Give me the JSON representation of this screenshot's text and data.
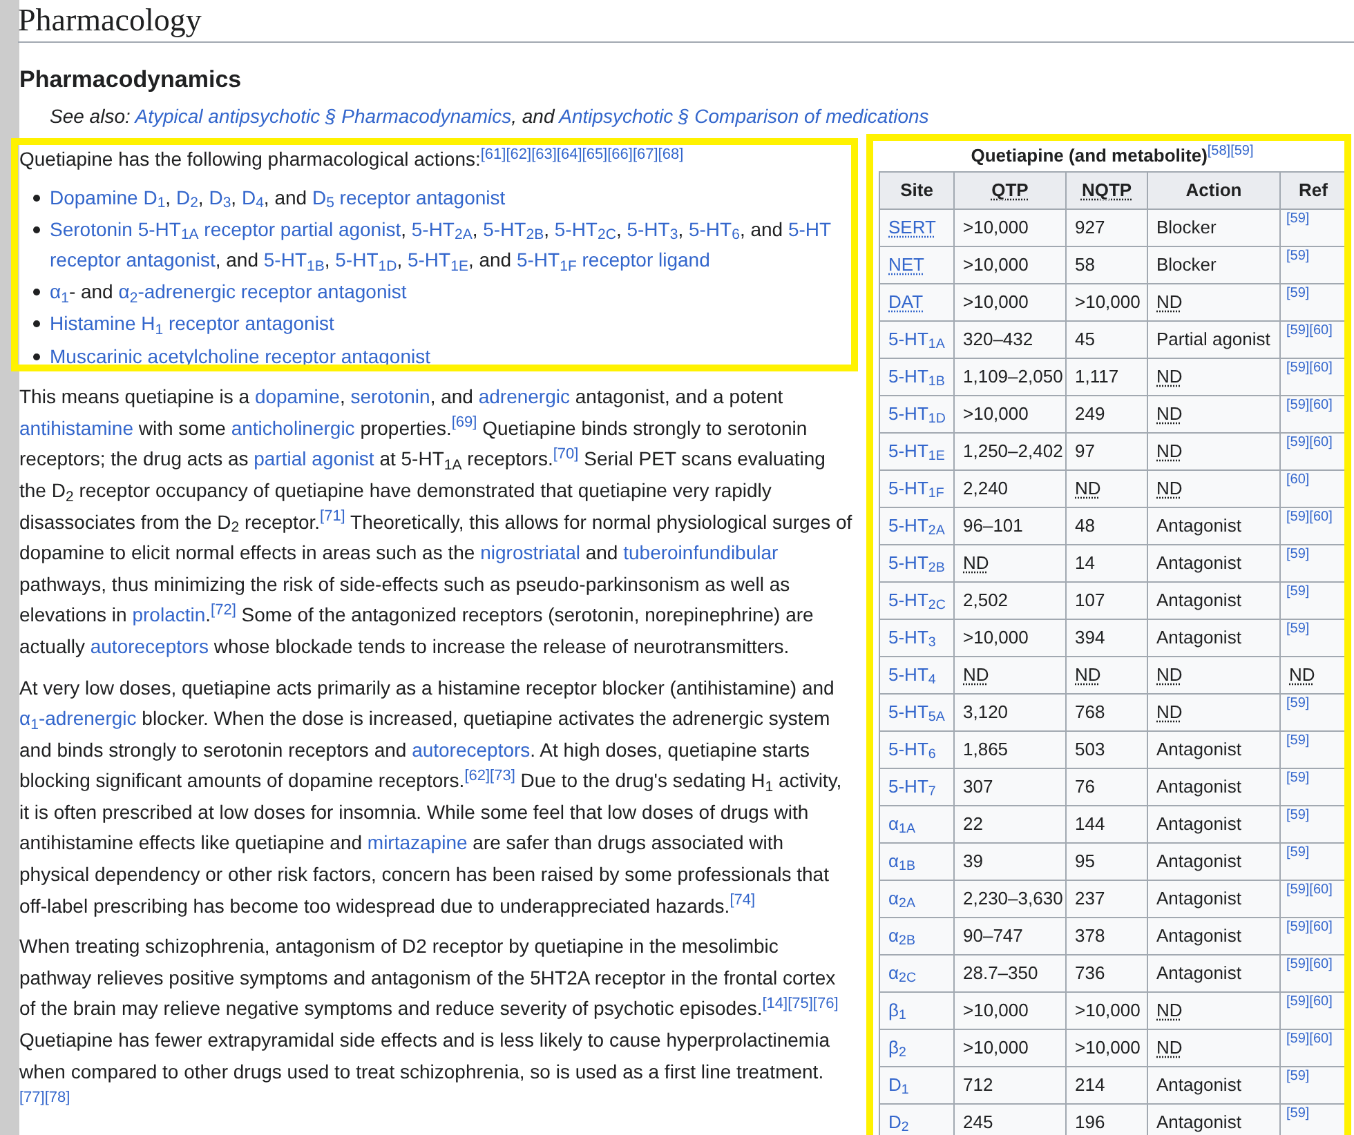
{
  "title": "Pharmacology",
  "section": "Pharmacodynamics",
  "see_also": [
    {
      "kind": "italic",
      "text": "See also: "
    },
    {
      "kind": "link",
      "text": "Atypical antipsychotic § Pharmacodynamics"
    },
    {
      "kind": "italic",
      "text": ", and "
    },
    {
      "kind": "link",
      "text": "Antipsychotic § Comparison of medications"
    }
  ],
  "intro": [
    {
      "kind": "text",
      "text": "Quetiapine has the following pharmacological actions:"
    },
    {
      "kind": "ref",
      "text": "[61][62][63][64][65][66][67][68]"
    }
  ],
  "bullets": [
    [
      {
        "kind": "link",
        "text": "Dopamine D$_{1}$"
      },
      {
        "kind": "text",
        "text": ", "
      },
      {
        "kind": "link",
        "text": "D$_{2}$"
      },
      {
        "kind": "text",
        "text": ", "
      },
      {
        "kind": "link",
        "text": "D$_{3}$"
      },
      {
        "kind": "text",
        "text": ", "
      },
      {
        "kind": "link",
        "text": "D$_{4}$"
      },
      {
        "kind": "text",
        "text": ", and "
      },
      {
        "kind": "link",
        "text": "D$_{5}$ receptor antagonist"
      }
    ],
    [
      {
        "kind": "link",
        "text": "Serotonin 5-HT$_{1A}$ receptor partial agonist"
      },
      {
        "kind": "text",
        "text": ", "
      },
      {
        "kind": "link",
        "text": "5-HT$_{2A}$"
      },
      {
        "kind": "text",
        "text": ", "
      },
      {
        "kind": "link",
        "text": "5-HT$_{2B}$"
      },
      {
        "kind": "text",
        "text": ", "
      },
      {
        "kind": "link",
        "text": "5-HT$_{2C}$"
      },
      {
        "kind": "text",
        "text": ", "
      },
      {
        "kind": "link",
        "text": "5-HT$_{3}$"
      },
      {
        "kind": "text",
        "text": ", "
      },
      {
        "kind": "link",
        "text": "5-HT$_{6}$"
      },
      {
        "kind": "text",
        "text": ", and "
      },
      {
        "kind": "link",
        "text": "5-HT"
      },
      {
        "kind": "link",
        "text": "receptor antagonist"
      },
      {
        "kind": "text",
        "text": ", and "
      },
      {
        "kind": "link",
        "text": "5-HT$_{1B}$"
      },
      {
        "kind": "text",
        "text": ", "
      },
      {
        "kind": "link",
        "text": "5-HT$_{1D}$"
      },
      {
        "kind": "text",
        "text": ", "
      },
      {
        "kind": "link",
        "text": "5-HT$_{1E}$"
      },
      {
        "kind": "text",
        "text": ", and "
      },
      {
        "kind": "link",
        "text": "5-HT$_{1F}$ receptor ligand"
      }
    ],
    [
      {
        "kind": "link",
        "text": "α$_{1}$"
      },
      {
        "kind": "text",
        "text": "- and "
      },
      {
        "kind": "link",
        "text": "α$_{2}$-adrenergic receptor antagonist"
      }
    ],
    [
      {
        "kind": "link",
        "text": "Histamine H$_{1}$ receptor antagonist"
      }
    ],
    [
      {
        "kind": "link",
        "text": "Muscarinic acetylcholine receptor antagonist"
      }
    ]
  ],
  "paragraphs": [
    [
      {
        "kind": "text",
        "text": "This means quetiapine is a "
      },
      {
        "kind": "link",
        "text": "dopamine"
      },
      {
        "kind": "text",
        "text": ", "
      },
      {
        "kind": "link",
        "text": "serotonin"
      },
      {
        "kind": "text",
        "text": ", and "
      },
      {
        "kind": "link",
        "text": "adrenergic"
      },
      {
        "kind": "text",
        "text": " antagonist, and a potent "
      },
      {
        "kind": "link",
        "text": "antihistamine"
      },
      {
        "kind": "text",
        "text": " with some "
      },
      {
        "kind": "link",
        "text": "anticholinergic"
      },
      {
        "kind": "text",
        "text": " properties."
      },
      {
        "kind": "ref",
        "text": "[69]"
      },
      {
        "kind": "text",
        "text": " Quetiapine binds strongly to serotonin receptors; the drug acts as "
      },
      {
        "kind": "link",
        "text": "partial agonist"
      },
      {
        "kind": "text",
        "text": " at 5-HT$_{1A}$ receptors."
      },
      {
        "kind": "ref",
        "text": "[70]"
      },
      {
        "kind": "text",
        "text": " Serial PET scans evaluating the D$_{2}$ receptor occupancy of quetiapine have demonstrated that quetiapine very rapidly disassociates from the D$_{2}$ receptor."
      },
      {
        "kind": "ref",
        "text": "[71]"
      },
      {
        "kind": "text",
        "text": " Theoretically, this allows for normal physiological surges of dopamine to elicit normal effects in areas such as the "
      },
      {
        "kind": "link",
        "text": "nigrostriatal"
      },
      {
        "kind": "text",
        "text": " and "
      },
      {
        "kind": "link",
        "text": "tuberoinfundibular"
      },
      {
        "kind": "text",
        "text": " pathways, thus minimizing the risk of side-effects such as pseudo-parkinsonism as well as elevations in "
      },
      {
        "kind": "link",
        "text": "prolactin"
      },
      {
        "kind": "text",
        "text": "."
      },
      {
        "kind": "ref",
        "text": "[72]"
      },
      {
        "kind": "text",
        "text": " Some of the antagonized receptors (serotonin, norepinephrine) are actually "
      },
      {
        "kind": "link",
        "text": "autoreceptors"
      },
      {
        "kind": "text",
        "text": " whose blockade tends to increase the release of neurotransmitters."
      }
    ],
    [
      {
        "kind": "text",
        "text": "At very low doses, quetiapine acts primarily as a histamine receptor blocker (antihistamine) and "
      },
      {
        "kind": "link",
        "text": "α$_{1}$-adrenergic"
      },
      {
        "kind": "text",
        "text": " blocker. When the dose is increased, quetiapine activates the adrenergic system and binds strongly to serotonin receptors and "
      },
      {
        "kind": "link",
        "text": "autoreceptors"
      },
      {
        "kind": "text",
        "text": ". At high doses, quetiapine starts blocking significant amounts of dopamine receptors."
      },
      {
        "kind": "ref",
        "text": "[62][73]"
      },
      {
        "kind": "text",
        "text": " Due to the drug's sedating H$_{1}$ activity, it is often prescribed at low doses for insomnia. While some feel that low doses of drugs with antihistamine effects like quetiapine and "
      },
      {
        "kind": "link",
        "text": "mirtazapine"
      },
      {
        "kind": "text",
        "text": " are safer than drugs associated with physical dependency or other risk factors, concern has been raised by some professionals that off-label prescribing has become too widespread due to underappreciated hazards."
      },
      {
        "kind": "ref",
        "text": "[74]"
      }
    ],
    [
      {
        "kind": "text",
        "text": "When treating schizophrenia, antagonism of D2 receptor by quetiapine in the mesolimbic pathway relieves positive symptoms and antagonism of the 5HT2A receptor in the frontal cortex of the brain may relieve negative symptoms and reduce severity of psychotic episodes."
      },
      {
        "kind": "ref",
        "text": "[14][75][76]"
      },
      {
        "kind": "text",
        "text": " Quetiapine has fewer extrapyramidal side effects and is less likely to cause hyperprolactinemia when compared to other drugs used to treat schizophrenia, so is used as a first line treatment."
      },
      {
        "kind": "ref",
        "text": "[77][78]"
      }
    ]
  ],
  "table": {
    "caption": "Quetiapine (and metabolite)",
    "caption_ref": "[58][59]",
    "columns": [
      {
        "label": "Site",
        "dotted": false
      },
      {
        "label": "QTP",
        "dotted": true
      },
      {
        "label": "NQTP",
        "dotted": true
      },
      {
        "label": "Action",
        "dotted": false
      },
      {
        "label": "Ref",
        "dotted": false
      }
    ],
    "rows": [
      {
        "cells": [
          {
            "text": "SERT",
            "abbr": true
          },
          {
            "text": ">10,000",
            "abbr": false
          },
          {
            "text": "927",
            "abbr": false
          },
          {
            "text": "Blocker",
            "abbr": false
          },
          {
            "text": "[59]",
            "abbr": false
          }
        ]
      },
      {
        "cells": [
          {
            "text": "NET",
            "abbr": true
          },
          {
            "text": ">10,000",
            "abbr": false
          },
          {
            "text": "58",
            "abbr": false
          },
          {
            "text": "Blocker",
            "abbr": false
          },
          {
            "text": "[59]",
            "abbr": false
          }
        ]
      },
      {
        "cells": [
          {
            "text": "DAT",
            "abbr": true
          },
          {
            "text": ">10,000",
            "abbr": false
          },
          {
            "text": ">10,000",
            "abbr": false
          },
          {
            "text": "ND",
            "abbr": true
          },
          {
            "text": "[59]",
            "abbr": false
          }
        ]
      },
      {
        "cells": [
          {
            "text": "5-HT$_{1A}$",
            "abbr": false
          },
          {
            "text": "320–432",
            "abbr": false
          },
          {
            "text": "45",
            "abbr": false
          },
          {
            "text": "Partial agonist",
            "abbr": false
          },
          {
            "text": "[59][60]",
            "abbr": false
          }
        ]
      },
      {
        "cells": [
          {
            "text": "5-HT$_{1B}$",
            "abbr": false
          },
          {
            "text": "1,109–2,050",
            "abbr": false
          },
          {
            "text": "1,117",
            "abbr": false
          },
          {
            "text": "ND",
            "abbr": true
          },
          {
            "text": "[59][60]",
            "abbr": false
          }
        ]
      },
      {
        "cells": [
          {
            "text": "5-HT$_{1D}$",
            "abbr": false
          },
          {
            "text": ">10,000",
            "abbr": false
          },
          {
            "text": "249",
            "abbr": false
          },
          {
            "text": "ND",
            "abbr": true
          },
          {
            "text": "[59][60]",
            "abbr": false
          }
        ]
      },
      {
        "cells": [
          {
            "text": "5-HT$_{1E}$",
            "abbr": false
          },
          {
            "text": "1,250–2,402",
            "abbr": false
          },
          {
            "text": "97",
            "abbr": false
          },
          {
            "text": "ND",
            "abbr": true
          },
          {
            "text": "[59][60]",
            "abbr": false
          }
        ]
      },
      {
        "cells": [
          {
            "text": "5-HT$_{1F}$",
            "abbr": false
          },
          {
            "text": "2,240",
            "abbr": false
          },
          {
            "text": "ND",
            "abbr": true
          },
          {
            "text": "ND",
            "abbr": true
          },
          {
            "text": "[60]",
            "abbr": false
          }
        ]
      },
      {
        "cells": [
          {
            "text": "5-HT$_{2A}$",
            "abbr": false
          },
          {
            "text": "96–101",
            "abbr": false
          },
          {
            "text": "48",
            "abbr": false
          },
          {
            "text": "Antagonist",
            "abbr": false
          },
          {
            "text": "[59][60]",
            "abbr": false
          }
        ]
      },
      {
        "cells": [
          {
            "text": "5-HT$_{2B}$",
            "abbr": false
          },
          {
            "text": "ND",
            "abbr": true
          },
          {
            "text": "14",
            "abbr": false
          },
          {
            "text": "Antagonist",
            "abbr": false
          },
          {
            "text": "[59]",
            "abbr": false
          }
        ]
      },
      {
        "cells": [
          {
            "text": "5-HT$_{2C}$",
            "abbr": false
          },
          {
            "text": "2,502",
            "abbr": false
          },
          {
            "text": "107",
            "abbr": false
          },
          {
            "text": "Antagonist",
            "abbr": false
          },
          {
            "text": "[59]",
            "abbr": false
          }
        ]
      },
      {
        "cells": [
          {
            "text": "5-HT$_{3}$",
            "abbr": false
          },
          {
            "text": ">10,000",
            "abbr": false
          },
          {
            "text": "394",
            "abbr": false
          },
          {
            "text": "Antagonist",
            "abbr": false
          },
          {
            "text": "[59]",
            "abbr": false
          }
        ]
      },
      {
        "cells": [
          {
            "text": "5-HT$_{4}$",
            "abbr": false
          },
          {
            "text": "ND",
            "abbr": true
          },
          {
            "text": "ND",
            "abbr": true
          },
          {
            "text": "ND",
            "abbr": true
          },
          {
            "text": "ND",
            "abbr": true
          }
        ]
      },
      {
        "cells": [
          {
            "text": "5-HT$_{5A}$",
            "abbr": false
          },
          {
            "text": "3,120",
            "abbr": false
          },
          {
            "text": "768",
            "abbr": false
          },
          {
            "text": "ND",
            "abbr": true
          },
          {
            "text": "[59]",
            "abbr": false
          }
        ]
      },
      {
        "cells": [
          {
            "text": "5-HT$_{6}$",
            "abbr": false
          },
          {
            "text": "1,865",
            "abbr": false
          },
          {
            "text": "503",
            "abbr": false
          },
          {
            "text": "Antagonist",
            "abbr": false
          },
          {
            "text": "[59]",
            "abbr": false
          }
        ]
      },
      {
        "cells": [
          {
            "text": "5-HT$_{7}$",
            "abbr": false
          },
          {
            "text": "307",
            "abbr": false
          },
          {
            "text": "76",
            "abbr": false
          },
          {
            "text": "Antagonist",
            "abbr": false
          },
          {
            "text": "[59]",
            "abbr": false
          }
        ]
      },
      {
        "cells": [
          {
            "text": "α$_{1A}$",
            "abbr": false
          },
          {
            "text": "22",
            "abbr": false
          },
          {
            "text": "144",
            "abbr": false
          },
          {
            "text": "Antagonist",
            "abbr": false
          },
          {
            "text": "[59]",
            "abbr": false
          }
        ]
      },
      {
        "cells": [
          {
            "text": "α$_{1B}$",
            "abbr": false
          },
          {
            "text": "39",
            "abbr": false
          },
          {
            "text": "95",
            "abbr": false
          },
          {
            "text": "Antagonist",
            "abbr": false
          },
          {
            "text": "[59]",
            "abbr": false
          }
        ]
      },
      {
        "cells": [
          {
            "text": "α$_{2A}$",
            "abbr": false
          },
          {
            "text": "2,230–3,630",
            "abbr": false
          },
          {
            "text": "237",
            "abbr": false
          },
          {
            "text": "Antagonist",
            "abbr": false
          },
          {
            "text": "[59][60]",
            "abbr": false
          }
        ]
      },
      {
        "cells": [
          {
            "text": "α$_{2B}$",
            "abbr": false
          },
          {
            "text": "90–747",
            "abbr": false
          },
          {
            "text": "378",
            "abbr": false
          },
          {
            "text": "Antagonist",
            "abbr": false
          },
          {
            "text": "[59][60]",
            "abbr": false
          }
        ]
      },
      {
        "cells": [
          {
            "text": "α$_{2C}$",
            "abbr": false
          },
          {
            "text": "28.7–350",
            "abbr": false
          },
          {
            "text": "736",
            "abbr": false
          },
          {
            "text": "Antagonist",
            "abbr": false
          },
          {
            "text": "[59][60]",
            "abbr": false
          }
        ]
      },
      {
        "cells": [
          {
            "text": "β$_{1}$",
            "abbr": false
          },
          {
            "text": ">10,000",
            "abbr": false
          },
          {
            "text": ">10,000",
            "abbr": false
          },
          {
            "text": "ND",
            "abbr": true
          },
          {
            "text": "[59][60]",
            "abbr": false
          }
        ]
      },
      {
        "cells": [
          {
            "text": "β$_{2}$",
            "abbr": false
          },
          {
            "text": ">10,000",
            "abbr": false
          },
          {
            "text": ">10,000",
            "abbr": false
          },
          {
            "text": "ND",
            "abbr": true
          },
          {
            "text": "[59][60]",
            "abbr": false
          }
        ]
      },
      {
        "cells": [
          {
            "text": "D$_{1}$",
            "abbr": false
          },
          {
            "text": "712",
            "abbr": false
          },
          {
            "text": "214",
            "abbr": false
          },
          {
            "text": "Antagonist",
            "abbr": false
          },
          {
            "text": "[59]",
            "abbr": false
          }
        ]
      },
      {
        "cells": [
          {
            "text": "D$_{2}$",
            "abbr": false
          },
          {
            "text": "245",
            "abbr": false
          },
          {
            "text": "196",
            "abbr": false
          },
          {
            "text": "Antagonist",
            "abbr": false
          },
          {
            "text": "[59]",
            "abbr": false
          }
        ]
      }
    ]
  }
}
